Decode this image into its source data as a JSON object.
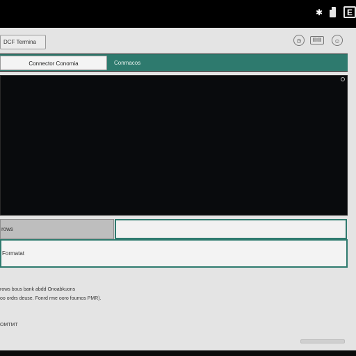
{
  "status_bar": {
    "icons": [
      "bluetooth-icon",
      "file-icon",
      "battery-icon"
    ],
    "battery_label": "E"
  },
  "toolbar": {
    "back_label": "DCF Termina",
    "icons": [
      "clock-icon",
      "keyboard-icon",
      "smile-icon"
    ]
  },
  "tabs": [
    {
      "label": "Connector Conomia",
      "active": true
    },
    {
      "label": "Conmacos",
      "active": false
    }
  ],
  "fields": {
    "left_label": "rows",
    "wide_label": "Formatat"
  },
  "info": {
    "line1": "rows bous bank abdd Onoabkuons",
    "line2": "oo ordrs deuse. Fonrd  rme ooro foumos PMR)."
  },
  "footer": {
    "label": "OMTMT"
  },
  "colors": {
    "accent": "#2e7a6e",
    "screen_bg": "#e4e4e4",
    "video_bg": "#090b0d"
  }
}
